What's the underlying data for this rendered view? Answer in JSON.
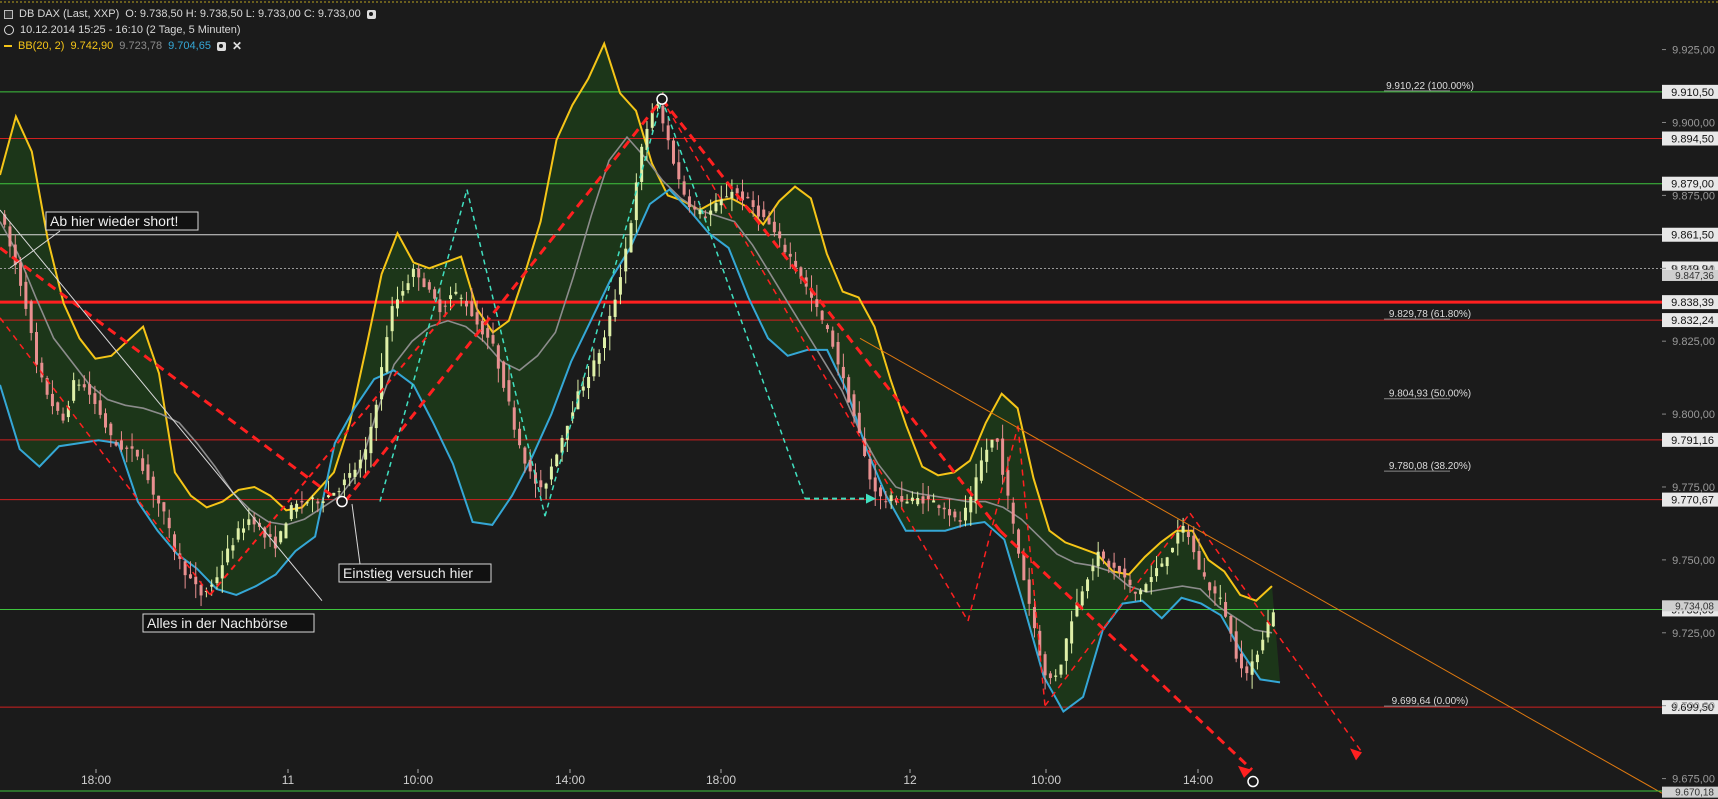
{
  "header": {
    "instrument": "DB DAX (Last, XXP)",
    "ohlc": "O: 9.738,50  H: 9.738,50  L: 9.733,00  C: 9.733,00",
    "period": "10.12.2014 15:25 - 16:10 (2 Tage, 5 Minuten)",
    "indicator_name": "BB(20, 2)",
    "bb_upper": "9.742,90",
    "bb_middle": "9.723,78",
    "bb_lower": "9.704,65"
  },
  "chart_data": {
    "type": "line",
    "x_ticks": [
      "18:00",
      "11",
      "10:00",
      "14:00",
      "18:00",
      "12",
      "10:00",
      "14:00"
    ],
    "y_ticks": [
      "9.925,00",
      "9.900,00",
      "9.875,00",
      "9.850,00",
      "9.825,00",
      "9.800,00",
      "9.775,00",
      "9.750,00",
      "9.725,00",
      "9.700,00",
      "9.675,00"
    ],
    "y_tick_values": [
      9925,
      9900,
      9875,
      9850,
      9825,
      9800,
      9775,
      9750,
      9725,
      9700,
      9675
    ],
    "ylim": [
      9668,
      9942
    ],
    "grid": false,
    "series": [
      {
        "name": "DB DAX",
        "values": [
          9870,
          9855,
          9840,
          9815,
          9805,
          9797,
          9812,
          9808,
          9800,
          9790,
          9788,
          9786,
          9775,
          9766,
          9752,
          9744,
          9738,
          9742,
          9752,
          9760,
          9765,
          9758,
          9755,
          9767,
          9770,
          9770,
          9772,
          9775,
          9780,
          9786,
          9807,
          9835,
          9843,
          9850,
          9842,
          9836,
          9842,
          9838,
          9830,
          9825,
          9810,
          9793,
          9780,
          9773,
          9785,
          9797,
          9808,
          9816,
          9826,
          9843,
          9864,
          9893,
          9908,
          9894,
          9878,
          9870,
          9868,
          9872,
          9877,
          9874,
          9870,
          9865,
          9858,
          9852,
          9843,
          9834,
          9825,
          9810,
          9796,
          9778,
          9770,
          9771,
          9770,
          9771,
          9770,
          9768,
          9762,
          9770,
          9786,
          9793,
          9770,
          9748,
          9728,
          9708,
          9712,
          9730,
          9742,
          9752,
          9748,
          9745,
          9738,
          9742,
          9748,
          9755,
          9762,
          9748,
          9740,
          9735,
          9718,
          9710,
          9722,
          9733
        ]
      },
      {
        "name": "BB(20, 2)",
        "values": [
          9882,
          9902,
          9890,
          9860,
          9838,
          9826,
          9819,
          9820,
          9825,
          9830,
          9814,
          9780,
          9772,
          9768,
          9770,
          9774,
          9775,
          9772,
          9767,
          9768,
          9774,
          9780,
          9797,
          9822,
          9848,
          9862,
          9852,
          9850,
          9852,
          9854,
          9836,
          9828,
          9832,
          9848,
          9866,
          9894,
          9906,
          9915,
          9927,
          9910,
          9904,
          9886,
          9875,
          9873,
          9870,
          9873,
          9874,
          9871,
          9865,
          9873,
          9878,
          9874,
          9855,
          9842,
          9840,
          9830,
          9812,
          9796,
          9782,
          9779,
          9780,
          9784,
          9797,
          9807,
          9802,
          9778,
          9760,
          9756,
          9754,
          9752,
          9746,
          9745,
          9751,
          9756,
          9760,
          9760,
          9750,
          9746,
          9738,
          9736,
          9741
        ]
      },
      {
        "name": "BB(20, 2) middle",
        "values": [
          9866,
          9855,
          9840,
          9826,
          9818,
          9810,
          9805,
          9803,
          9802,
          9800,
          9797,
          9790,
          9782,
          9773,
          9767,
          9763,
          9762,
          9764,
          9768,
          9772,
          9780,
          9800,
          9817,
          9825,
          9830,
          9832,
          9830,
          9825,
          9818,
          9815,
          9820,
          9828,
          9847,
          9868,
          9887,
          9895,
          9888,
          9880,
          9874,
          9870,
          9868,
          9866,
          9858,
          9848,
          9838,
          9828,
          9818,
          9808,
          9794,
          9783,
          9775,
          9773,
          9772,
          9771,
          9770,
          9770,
          9768,
          9764,
          9758,
          9752,
          9749,
          9748,
          9746,
          9741,
          9739,
          9740,
          9741,
          9740,
          9734,
          9730,
          9726,
          9725
        ]
      },
      {
        "name": "BB(20, 2) lower",
        "values": [
          9810,
          9788,
          9782,
          9789,
          9790,
          9791,
          9790,
          9770,
          9760,
          9752,
          9747,
          9740,
          9738,
          9741,
          9745,
          9753,
          9758,
          9790,
          9802,
          9812,
          9815,
          9810,
          9797,
          9783,
          9763,
          9762,
          9772,
          9785,
          9800,
          9818,
          9832,
          9846,
          9857,
          9872,
          9877,
          9870,
          9862,
          9857,
          9840,
          9826,
          9820,
          9822,
          9822,
          9808,
          9788,
          9772,
          9760,
          9760,
          9760,
          9762,
          9763,
          9757,
          9734,
          9710,
          9698,
          9703,
          9726,
          9735,
          9736,
          9730,
          9737,
          9735,
          9731,
          9719,
          9709,
          9708
        ]
      }
    ],
    "levels": [
      {
        "value": 9910.5,
        "label": "9.910,50",
        "color": "#3ec43e",
        "fib": "9.910,22 (100.00%)"
      },
      {
        "value": 9894.5,
        "label": "9.894,50",
        "color": "#d02020"
      },
      {
        "value": 9879.0,
        "label": "9.879,00",
        "color": "#3ec43e"
      },
      {
        "value": 9861.5,
        "label": "9.861,50",
        "color": "#d8d8d8"
      },
      {
        "value": 9849.94,
        "label": "9.849,94",
        "color": "#9a9a9a",
        "dotted": true
      },
      {
        "value": 9838.39,
        "label": "9.838,39",
        "color": "#ff2020",
        "thick": true
      },
      {
        "value": 9832.24,
        "label": "9.832,24",
        "color": "#d02020",
        "fib": "9.829,78 (61.80%)"
      },
      {
        "value": 9791.16,
        "label": "9.791,16",
        "color": "#d02020"
      },
      {
        "value": 9770.67,
        "label": "9.770,67",
        "color": "#d02020"
      },
      {
        "value": 9733.0,
        "label": "9.733,00",
        "color": "#3ec43e"
      },
      {
        "value": 9699.5,
        "label": "9.699,50",
        "color": "#d02020",
        "fib": "9.699,64 (0.00%)"
      }
    ],
    "fib_only": [
      {
        "value": 9804.93,
        "fib": "9.804,93 (50.00%)"
      },
      {
        "value": 9780.08,
        "fib": "9.780,08 (38.20%)"
      }
    ],
    "partial_labels": [
      "9.734,08",
      "9.847,36",
      "9.670,18"
    ],
    "annotations": [
      "Ab hier wieder short!",
      "Einstieg versuch hier",
      "Alles in der Nachbörse"
    ],
    "colors": {
      "background": "#1b1b1b",
      "up_candle": "#dff0a8",
      "down_candle": "#e89090",
      "bb_upper": "#f5c518",
      "bb_middle": "#8c8c8c",
      "bb_lower": "#35a7d6",
      "band_fill": "#1d3a19",
      "trend_red": "#ff2020",
      "trend_cyan": "#40e0c0",
      "trend_orange": "#e07a10"
    }
  }
}
